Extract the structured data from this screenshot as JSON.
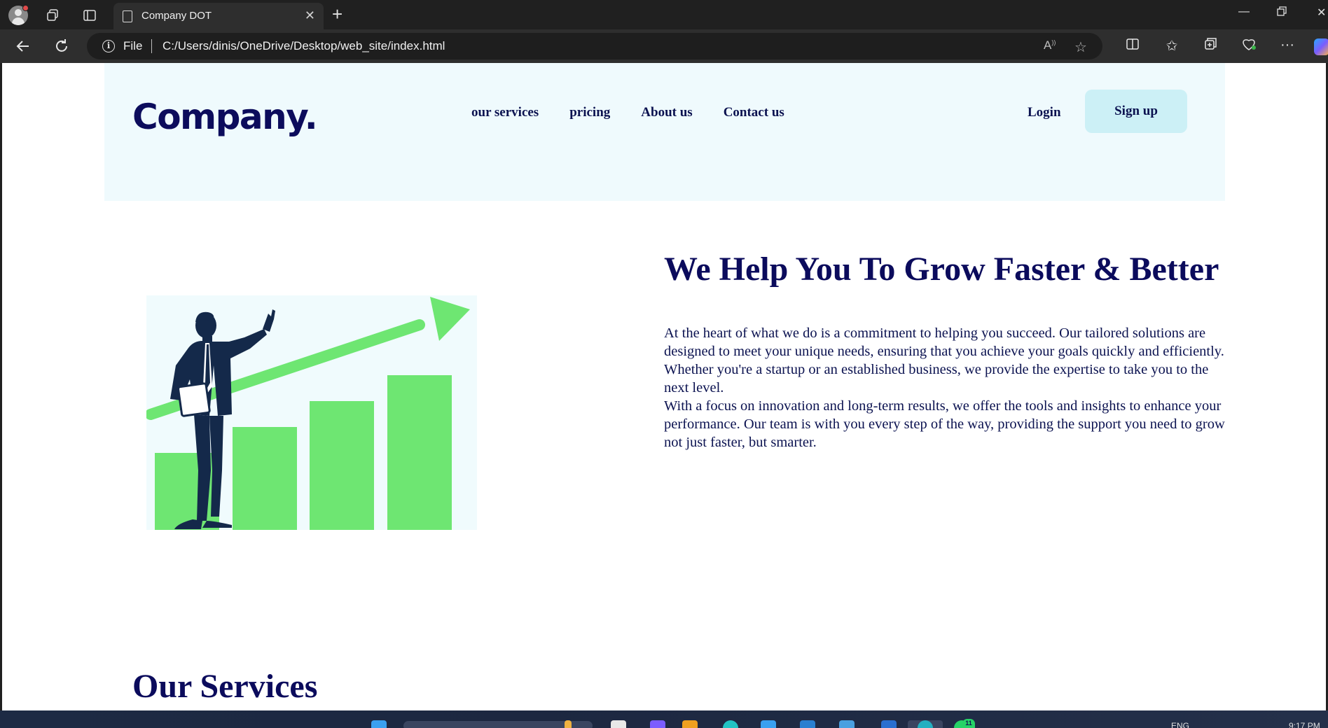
{
  "browser": {
    "tab_title": "Company DOT",
    "address_prefix": "File",
    "url": "C:/Users/dinis/OneDrive/Desktop/web_site/index.html"
  },
  "site": {
    "logo": "Company.",
    "nav": [
      "our services",
      "pricing",
      "About us",
      "Contact us"
    ],
    "login": "Login",
    "signup": "Sign up",
    "hero": {
      "title": "We Help You To Grow Faster & Better",
      "paragraph1": "At the heart of what we do is a commitment to helping you succeed. Our tailored solutions are designed to meet your unique needs, ensuring that you achieve your goals quickly and efficiently. Whether you're a startup or an established business, we provide the expertise to take you to the next level.",
      "paragraph2": "With a focus on innovation and long-term results, we offer the tools and insights to enhance your performance. Our team is with you every step of the way, providing the support you need to grow not just faster, but smarter."
    },
    "services_title": "Our Services"
  },
  "taskbar": {
    "language": "ENG",
    "time": "9:17 PM",
    "badge_count": "11"
  },
  "colors": {
    "navy": "#0b0b5c",
    "header_bg": "#effafd",
    "signup_bg": "#ccf0f6",
    "chart_green": "#6ee672"
  }
}
